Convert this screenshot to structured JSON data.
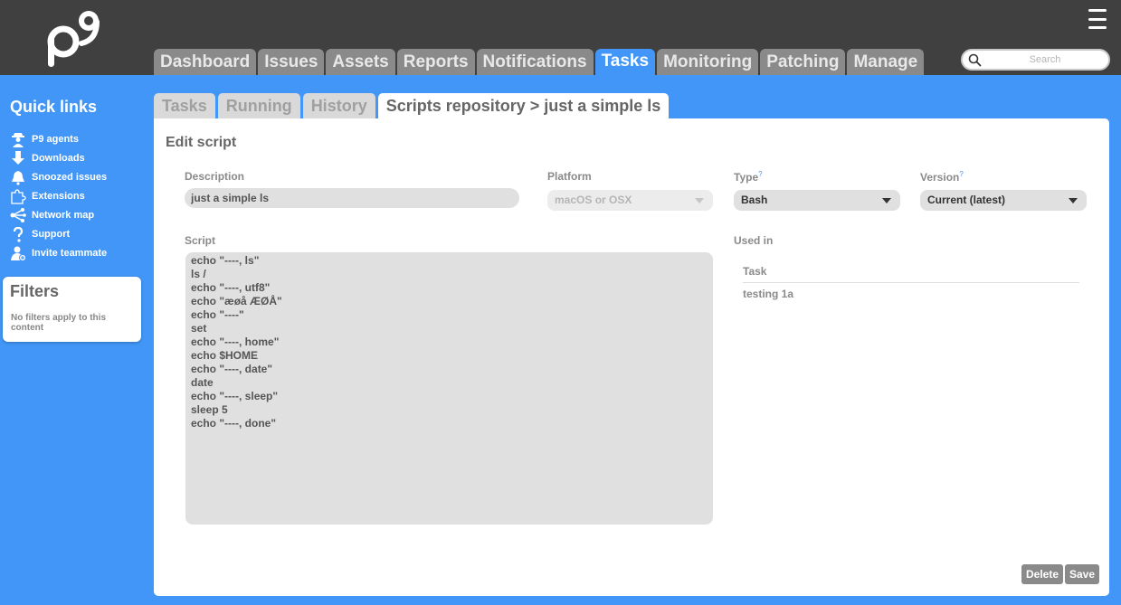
{
  "header": {
    "logo_text": "p9",
    "menu_icon": "hamburger-icon",
    "search_placeholder": "Search",
    "search_icon": "search-icon"
  },
  "main_tabs": [
    {
      "label": "Dashboard",
      "active": false
    },
    {
      "label": "Issues",
      "active": false
    },
    {
      "label": "Assets",
      "active": false
    },
    {
      "label": "Reports",
      "active": false
    },
    {
      "label": "Notifications",
      "active": false
    },
    {
      "label": "Tasks",
      "active": true
    },
    {
      "label": "Monitoring",
      "active": false
    },
    {
      "label": "Patching",
      "active": false
    },
    {
      "label": "Manage",
      "active": false
    }
  ],
  "sidebar": {
    "quick_links_title": "Quick links",
    "items": [
      {
        "label": "P9 agents",
        "icon": "agent-icon"
      },
      {
        "label": "Downloads",
        "icon": "download-icon"
      },
      {
        "label": "Snoozed issues",
        "icon": "bell-icon"
      },
      {
        "label": "Extensions",
        "icon": "puzzle-icon"
      },
      {
        "label": "Network map",
        "icon": "network-icon"
      },
      {
        "label": "Support",
        "icon": "question-icon"
      },
      {
        "label": "Invite teammate",
        "icon": "user-add-icon"
      }
    ],
    "filters_title": "Filters",
    "filters_text": "No filters apply to this content"
  },
  "sub_tabs": [
    {
      "label": "Tasks",
      "active": false
    },
    {
      "label": "Running",
      "active": false
    },
    {
      "label": "History",
      "active": false
    },
    {
      "label": "Scripts repository > just a simple ls",
      "active": true
    }
  ],
  "form": {
    "title": "Edit script",
    "description_label": "Description",
    "description_value": "just a simple ls",
    "platform_label": "Platform",
    "platform_value": "macOS or OSX",
    "type_label": "Type",
    "type_value": "Bash",
    "version_label": "Version",
    "version_value": "Current (latest)",
    "help_mark": "?",
    "script_label": "Script",
    "script_value": "echo \"----, ls\"\nls /\necho \"----, utf8\"\necho \"æøå ÆØÅ\"\necho \"----\"\nset\necho \"----, home\"\necho $HOME\necho \"----, date\"\ndate\necho \"----, sleep\"\nsleep 5\necho \"----, done\"",
    "used_in_label": "Used in",
    "used_in_column": "Task",
    "used_in_rows": [
      "testing 1a"
    ],
    "delete_label": "Delete",
    "save_label": "Save"
  },
  "colors": {
    "background": "#4196f8",
    "topbar": "#404040",
    "tab_inactive": "#8a8a8a",
    "accent": "#4196f8"
  }
}
